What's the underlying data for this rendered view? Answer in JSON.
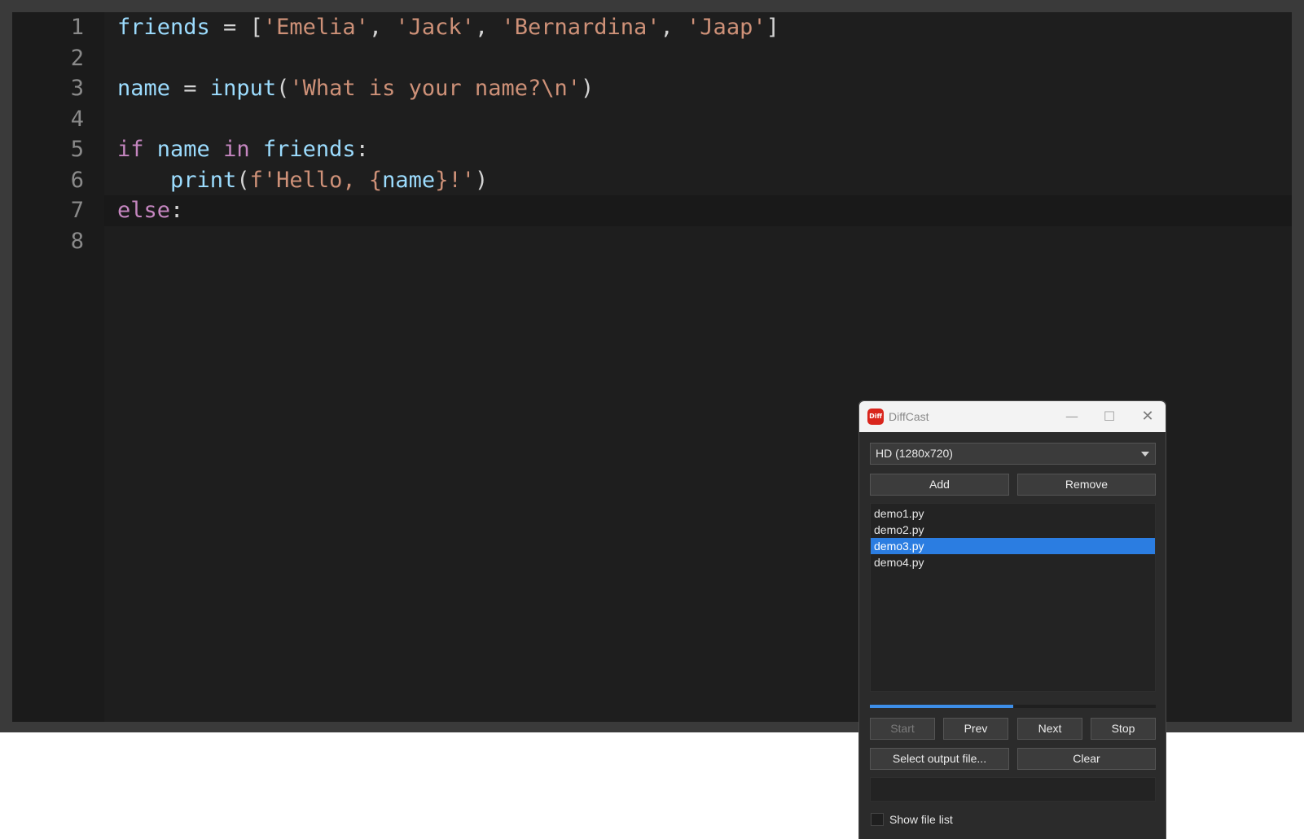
{
  "editor": {
    "line_numbers": [
      "1",
      "2",
      "3",
      "4",
      "5",
      "6",
      "7",
      "8"
    ],
    "current_line": 7,
    "lines": [
      [
        {
          "t": "friends",
          "c": "var"
        },
        {
          "t": " = [",
          "c": "op"
        },
        {
          "t": "'Emelia'",
          "c": "str"
        },
        {
          "t": ", ",
          "c": "op"
        },
        {
          "t": "'Jack'",
          "c": "str"
        },
        {
          "t": ", ",
          "c": "op"
        },
        {
          "t": "'Bernardina'",
          "c": "str"
        },
        {
          "t": ", ",
          "c": "op"
        },
        {
          "t": "'Jaap'",
          "c": "str"
        },
        {
          "t": "]",
          "c": "op"
        }
      ],
      [],
      [
        {
          "t": "name",
          "c": "var"
        },
        {
          "t": " = ",
          "c": "op"
        },
        {
          "t": "input",
          "c": "fn"
        },
        {
          "t": "(",
          "c": "op"
        },
        {
          "t": "'What is your name?\\n'",
          "c": "str"
        },
        {
          "t": ")",
          "c": "op"
        }
      ],
      [],
      [
        {
          "t": "if",
          "c": "kw"
        },
        {
          "t": " ",
          "c": "op"
        },
        {
          "t": "name",
          "c": "var"
        },
        {
          "t": " ",
          "c": "op"
        },
        {
          "t": "in",
          "c": "kw"
        },
        {
          "t": " ",
          "c": "op"
        },
        {
          "t": "friends",
          "c": "var"
        },
        {
          "t": ":",
          "c": "op"
        }
      ],
      [
        {
          "t": "    ",
          "c": "op"
        },
        {
          "t": "print",
          "c": "fn"
        },
        {
          "t": "(",
          "c": "op"
        },
        {
          "t": "f'Hello, ",
          "c": "str"
        },
        {
          "t": "{",
          "c": "str"
        },
        {
          "t": "name",
          "c": "var"
        },
        {
          "t": "}",
          "c": "str"
        },
        {
          "t": "!'",
          "c": "str"
        },
        {
          "t": ")",
          "c": "op"
        }
      ],
      [
        {
          "t": "else",
          "c": "kw"
        },
        {
          "t": ":",
          "c": "op"
        }
      ],
      []
    ]
  },
  "diffcast": {
    "app_icon_text": "Diff",
    "title": "DiffCast",
    "minimize_glyph": "—",
    "maximize_glyph": "☐",
    "close_glyph": "✕",
    "resolution_select": {
      "value": "HD (1280x720)"
    },
    "add_label": "Add",
    "remove_label": "Remove",
    "files": [
      "demo1.py",
      "demo2.py",
      "demo3.py",
      "demo4.py"
    ],
    "selected_file_index": 2,
    "progress": 0.5,
    "start_label": "Start",
    "prev_label": "Prev",
    "next_label": "Next",
    "stop_label": "Stop",
    "select_output_label": "Select output file...",
    "clear_label": "Clear",
    "output_path": "",
    "show_file_list_label": "Show file list",
    "show_file_list_checked": false
  },
  "colors": {
    "var": "#9cdcfe",
    "str": "#ce9178",
    "kw": "#c586c0",
    "fn": "#9cdcfe",
    "op": "#d4d4d4",
    "selection": "#2b7de1",
    "progress": "#3d8ee8"
  }
}
